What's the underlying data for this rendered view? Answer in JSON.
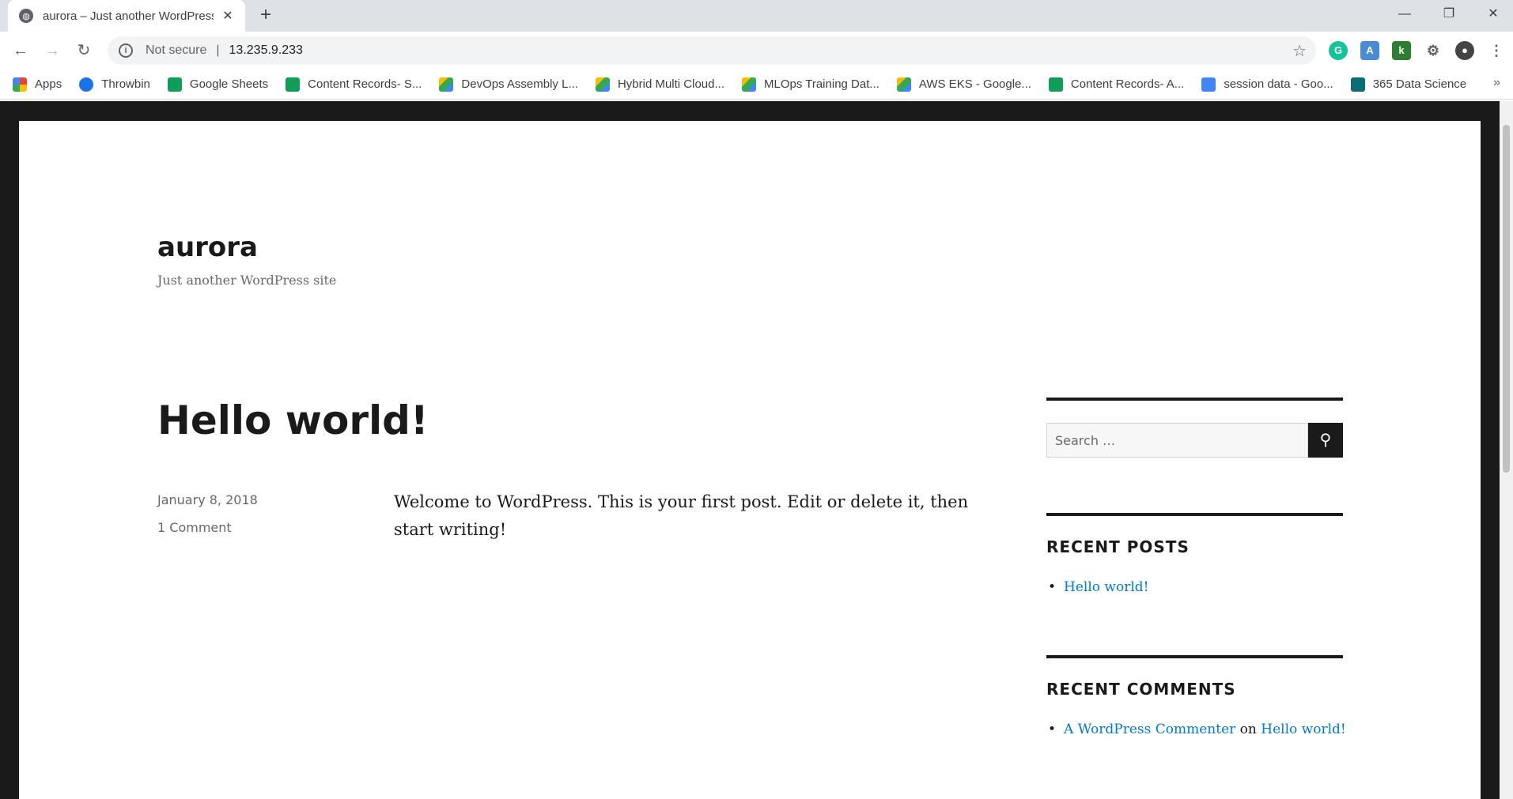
{
  "browser": {
    "tab_title": "aurora – Just another WordPress site",
    "security_label": "Not secure",
    "url": "13.235.9.233",
    "bookmarks": [
      {
        "label": "Apps",
        "color": "#ea4335"
      },
      {
        "label": "Throwbin",
        "color": "#1a73e8"
      },
      {
        "label": "Google Sheets",
        "color": "#0f9d58"
      },
      {
        "label": "Content Records- S...",
        "color": "#0f9d58"
      },
      {
        "label": "DevOps Assembly L...",
        "color": "#fbbc04"
      },
      {
        "label": "Hybrid Multi Cloud...",
        "color": "#fbbc04"
      },
      {
        "label": "MLOps Training Dat...",
        "color": "#fbbc04"
      },
      {
        "label": "AWS EKS - Google...",
        "color": "#fbbc04"
      },
      {
        "label": "Content Records- A...",
        "color": "#0f9d58"
      },
      {
        "label": "session data - Goo...",
        "color": "#4285f4"
      },
      {
        "label": "365 Data Science",
        "color": "#0a6e73"
      }
    ],
    "more_bookmarks": "»"
  },
  "site": {
    "title": "aurora",
    "description": "Just another WordPress site"
  },
  "post": {
    "title": "Hello world!",
    "date": "January 8, 2018",
    "comments": "1 Comment",
    "body": "Welcome to WordPress. This is your first post. Edit or delete it, then start writing!"
  },
  "sidebar": {
    "search_placeholder": "Search …",
    "recent_posts_title": "RECENT POSTS",
    "recent_posts": [
      "Hello world!"
    ],
    "recent_comments_title": "RECENT COMMENTS",
    "recent_comment": {
      "author": "A WordPress Commenter",
      "on": "on",
      "post": "Hello world!"
    }
  },
  "colors": {
    "link": "#007acc",
    "dark": "#1a1a1a"
  }
}
